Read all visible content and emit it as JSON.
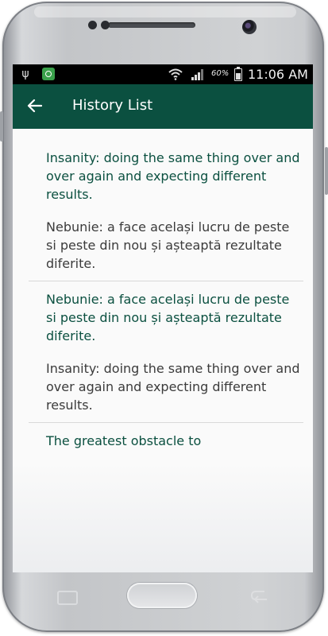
{
  "status_bar": {
    "icons": [
      "usb-icon",
      "app-notification-icon",
      "wifi-icon",
      "signal-icon",
      "battery-icon"
    ],
    "battery": "60%",
    "time": "11:06 AM"
  },
  "app_bar": {
    "back_icon": "arrow-left",
    "title": "History List",
    "color": "#0b5040"
  },
  "history": [
    {
      "source": "Insanity: doing the same thing over and over again and expecting different results.",
      "translation": "Nebunie: a face același lucru de peste si peste din nou și așteaptă rezultate diferite."
    },
    {
      "source": "Nebunie: a face același lucru de peste si peste din nou și așteaptă rezultate diferite.",
      "translation": "Insanity: doing the same thing over and over again and expecting different results."
    },
    {
      "source": "The greatest obstacle to",
      "translation": ""
    }
  ],
  "colors": {
    "source_text": "#0b5040",
    "translation_text": "#3b3b3b"
  }
}
